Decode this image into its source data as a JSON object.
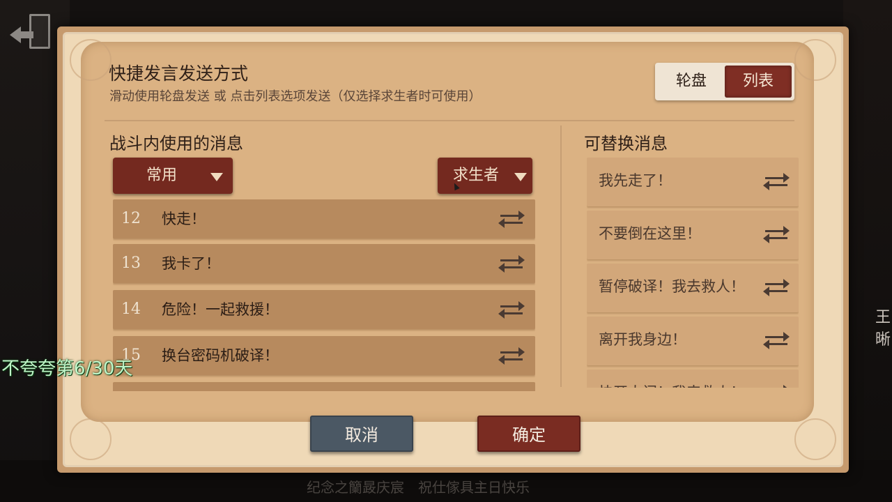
{
  "background": {
    "ticker_text": "纪念之籣晸庆宸　祝仕傢具主日快乐",
    "right_edge_glyphs": "王\n晰"
  },
  "back_button": {
    "icon": "exit-door-icon"
  },
  "dialog": {
    "title": "快捷发言发送方式",
    "subtitle": "滑动使用轮盘发送 或 点击列表选项发送（仅选择求生者时可使用）",
    "mode_toggle": {
      "options": [
        "轮盘",
        "列表"
      ],
      "selected": "列表"
    },
    "left_section": {
      "title": "战斗内使用的消息",
      "category_dropdown": {
        "value": "常用",
        "icon": "caret-down-icon"
      },
      "role_dropdown": {
        "value": "求生者",
        "icon": "caret-down-icon"
      },
      "messages": [
        {
          "num": "12",
          "text": "快走！"
        },
        {
          "num": "13",
          "text": "我卡了！"
        },
        {
          "num": "14",
          "text": "危险！一起救援！"
        },
        {
          "num": "15",
          "text": "换台密码机破译！"
        }
      ]
    },
    "right_section": {
      "title": "可替换消息",
      "messages": [
        {
          "text": "我先走了！"
        },
        {
          "text": "不要倒在这里！"
        },
        {
          "text": "暂停破译！我去救人！"
        },
        {
          "text": "离开我身边！"
        },
        {
          "text": "快开大门！我来救人！"
        }
      ]
    },
    "buttons": {
      "cancel": "取消",
      "confirm": "确定"
    }
  },
  "overlay": {
    "text": "不夸夸第6/30天"
  },
  "colors": {
    "accent_red": "#7a2c22",
    "cancel_slate": "#4b5864",
    "parchment": "#dbb283",
    "row_bg": "#b78a5e"
  }
}
